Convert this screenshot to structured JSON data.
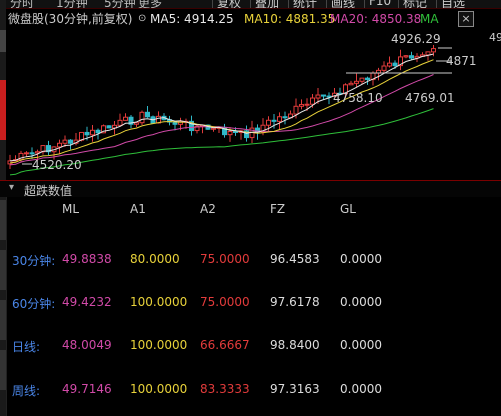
{
  "toolbar": {
    "items": [
      "分时",
      "1分钟",
      "5分钟",
      "更多"
    ],
    "buttons": [
      "复权",
      "叠加",
      "统计",
      "画线",
      "F10",
      "标记",
      "自选"
    ]
  },
  "legend": {
    "title": "微盘股(30分钟,前复权)",
    "ma5": "MA5: 4914.25",
    "ma10": "MA10: 4881.35",
    "ma20": "MA20: 4850.38",
    "ma_more": "MA",
    "close_label": "×",
    "right_axis_value": "49"
  },
  "colors": {
    "ma5": "#e8e8e8",
    "ma10": "#e8d23a",
    "ma20": "#d14aa8",
    "ma60": "#2fbf3a",
    "up": "#e23b3b",
    "down": "#2fb8c8",
    "label": "#4a86e8"
  },
  "chart_annotations": {
    "high": "4926.29",
    "level_right": "4871",
    "low_left": "4758.10",
    "low_right": "4769.01",
    "min": "4520.20"
  },
  "chart_data": {
    "type": "candlestick",
    "title": "微盘股(30分钟,前复权)",
    "series": [
      {
        "name": "MA5",
        "last": 4914.25
      },
      {
        "name": "MA10",
        "last": 4881.35
      },
      {
        "name": "MA20",
        "last": 4850.38
      }
    ],
    "annotated_prices": [
      4926.29,
      4871,
      4758.1,
      4769.01,
      4520.2
    ]
  },
  "panel": {
    "toggle_label": "▾",
    "title": "超跌数值",
    "columns": [
      "ML",
      "A1",
      "A2",
      "FZ",
      "GL"
    ],
    "rows": [
      {
        "label": "30分钟:",
        "ml": "49.8838",
        "a1": "80.0000",
        "a2": "75.0000",
        "fz": "96.4583",
        "gl": "0.0000"
      },
      {
        "label": "60分钟:",
        "ml": "49.4232",
        "a1": "100.0000",
        "a2": "75.0000",
        "fz": "97.6178",
        "gl": "0.0000"
      },
      {
        "label": "日线:",
        "ml": "48.0049",
        "a1": "100.0000",
        "a2": "66.6667",
        "fz": "98.8400",
        "gl": "0.0000"
      },
      {
        "label": "周线:",
        "ml": "49.7146",
        "a1": "100.0000",
        "a2": "83.3333",
        "fz": "97.3163",
        "gl": "0.0000"
      }
    ]
  }
}
